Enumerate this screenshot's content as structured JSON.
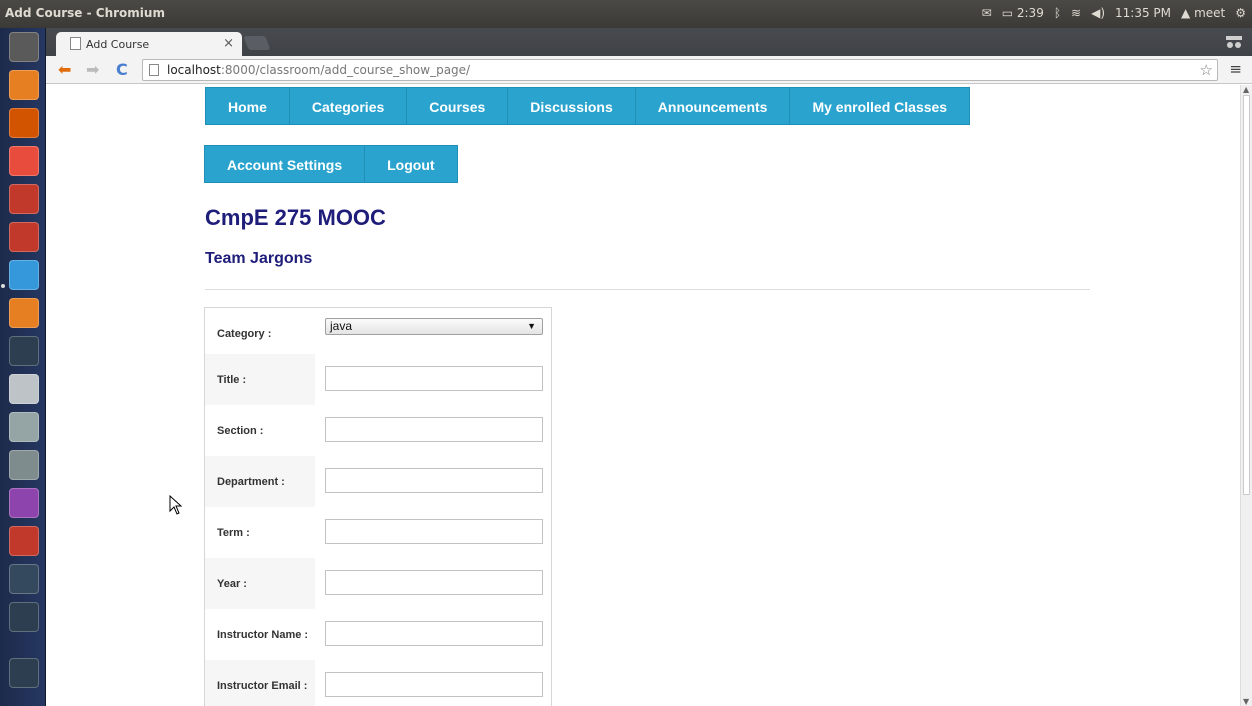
{
  "os_panel": {
    "window_title": "Add Course - Chromium",
    "battery": "2:39",
    "clock": "11:35 PM",
    "user": "meet"
  },
  "browser": {
    "tab_title": "Add Course",
    "url_host": "localhost",
    "url_rest": ":8000/classroom/add_course_show_page/"
  },
  "nav_primary": [
    "Home",
    "Categories",
    "Courses",
    "Discussions",
    "Announcements",
    "My enrolled Classes"
  ],
  "nav_secondary": [
    "Account Settings",
    "Logout"
  ],
  "site_title": "CmpE 275 MOOC",
  "site_subtitle": "Team Jargons",
  "form": {
    "category_label": "Category :",
    "category_value": "java",
    "fields": [
      {
        "label": "Title :",
        "value": ""
      },
      {
        "label": "Section :",
        "value": ""
      },
      {
        "label": "Department :",
        "value": ""
      },
      {
        "label": "Term :",
        "value": ""
      },
      {
        "label": "Year :",
        "value": ""
      },
      {
        "label": "Instructor Name :",
        "value": ""
      },
      {
        "label": "Instructor Email :",
        "value": ""
      }
    ]
  },
  "colors": {
    "nav_bg": "#2aa4cf",
    "heading": "#1f1d7a"
  }
}
